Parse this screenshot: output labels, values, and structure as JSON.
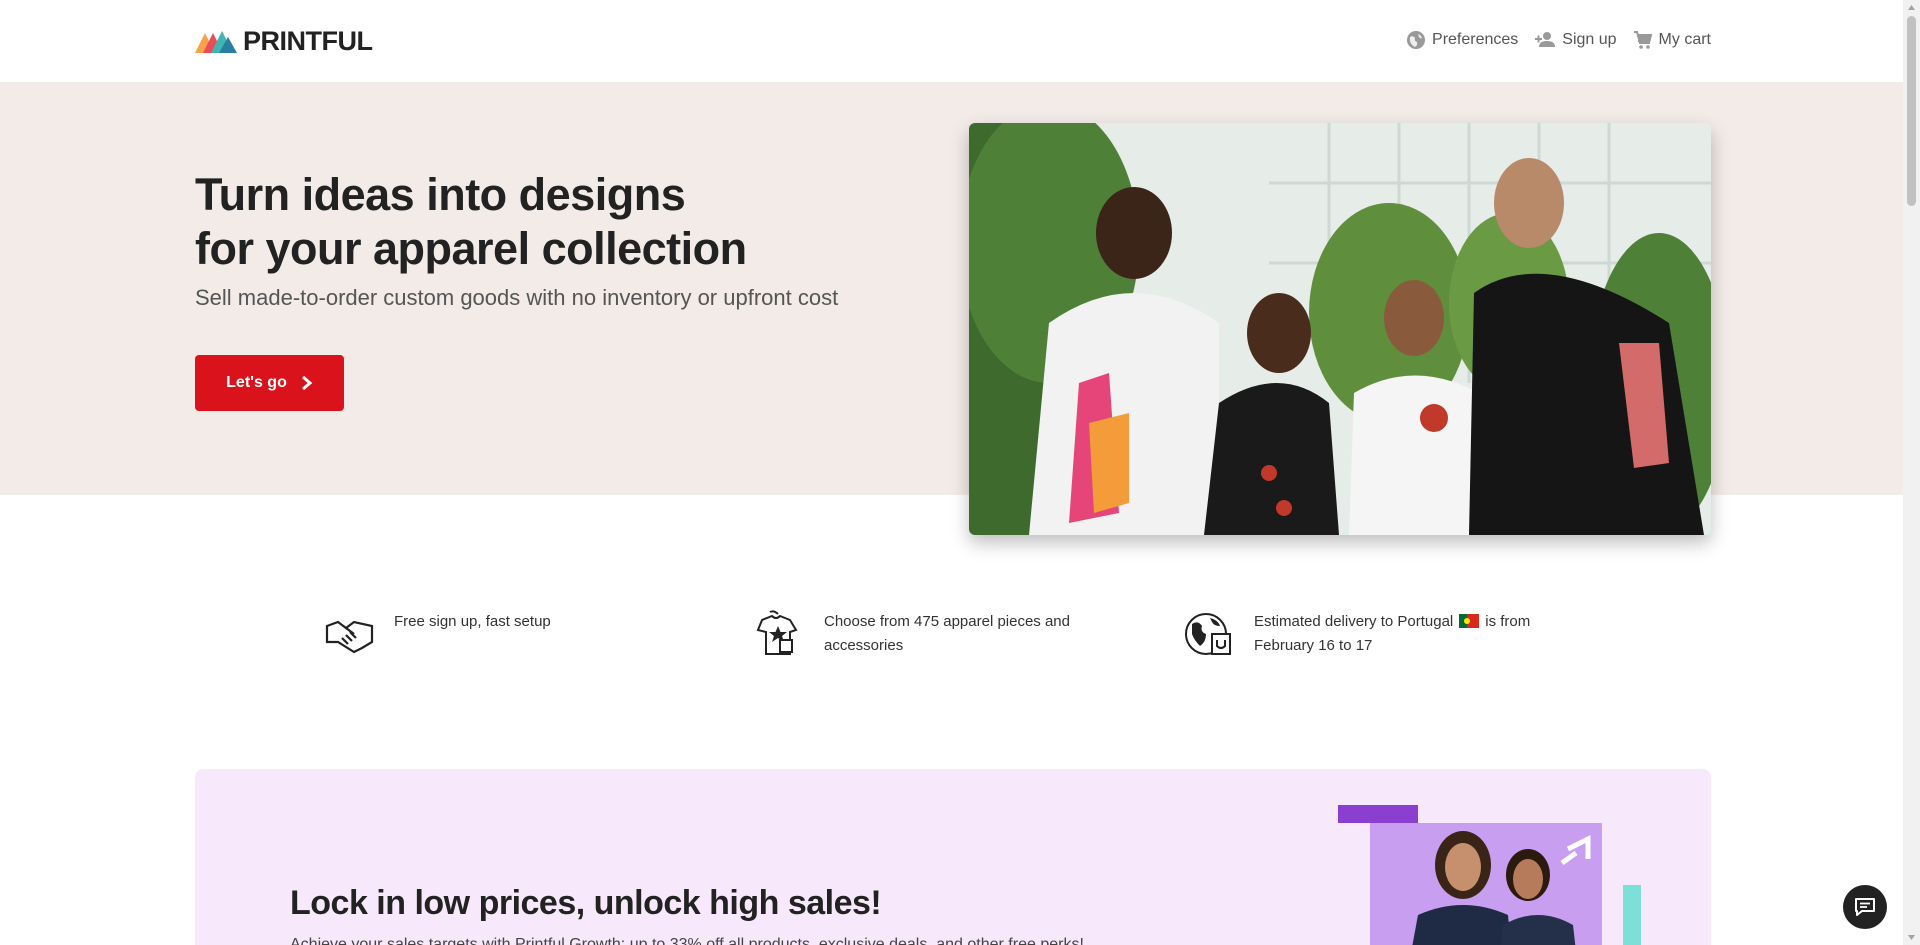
{
  "header": {
    "logo_text": "PRINTFUL",
    "nav": {
      "preferences": "Preferences",
      "sign_up": "Sign up",
      "cart": "My cart"
    }
  },
  "hero": {
    "title_line1": "Turn ideas into designs",
    "title_line2": "for your apparel collection",
    "subtitle": "Sell made-to-order custom goods with no inventory or upfront cost",
    "cta_label": "Let's go"
  },
  "features": {
    "signup": "Free sign up, fast setup",
    "choose": "Choose from 475 apparel pieces and accessories",
    "delivery_prefix": "Estimated delivery to Portugal",
    "delivery_suffix": "is from February 16 to 17"
  },
  "promo": {
    "title": "Lock in low prices, unlock high sales!",
    "subtitle": "Achieve your sales targets with Printful Growth: up to 33% off all products, exclusive deals, and other free perks!"
  },
  "colors": {
    "brand_red": "#d9121c",
    "hero_bg": "#f2ebe8",
    "promo_bg": "#f8e8fb"
  },
  "icons": [
    "globe-icon",
    "add-user-icon",
    "cart-icon",
    "handshake-icon",
    "tshirt-icon",
    "globe-package-icon",
    "chat-icon",
    "chevron-right-icon"
  ]
}
